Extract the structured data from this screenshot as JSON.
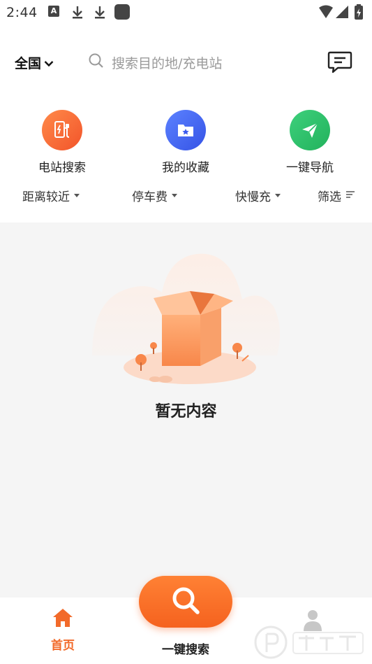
{
  "status_bar": {
    "time": "2:44",
    "notification_letter": "A",
    "icons": [
      "text-notification-icon",
      "download-icon",
      "download-icon",
      "app-notification-icon",
      "wifi-icon",
      "signal-icon",
      "battery-charging-icon"
    ]
  },
  "header": {
    "region_label": "全国",
    "search_placeholder": "搜索目的地/充电站",
    "icons": [
      "chevron-down-icon",
      "search-icon",
      "message-icon"
    ]
  },
  "quick_actions": [
    {
      "label": "电站搜索",
      "icon": "charging-station-icon",
      "color": "#f26a2a"
    },
    {
      "label": "我的收藏",
      "icon": "favorites-folder-icon",
      "color": "#3b5bee"
    },
    {
      "label": "一键导航",
      "icon": "navigation-arrow-icon",
      "color": "#2bbf6a"
    }
  ],
  "filters": [
    {
      "label": "距离较近"
    },
    {
      "label": "停车费"
    },
    {
      "label": "快慢充"
    },
    {
      "label": "筛选"
    }
  ],
  "empty_state": {
    "text": "暂无内容",
    "illustration": "empty-box-illustration"
  },
  "bottom_nav": {
    "home_label": "首页",
    "search_label": "一键搜索",
    "accent_color": "#f26a2a",
    "icons": [
      "home-icon",
      "search-icon",
      "profile-icon"
    ]
  }
}
